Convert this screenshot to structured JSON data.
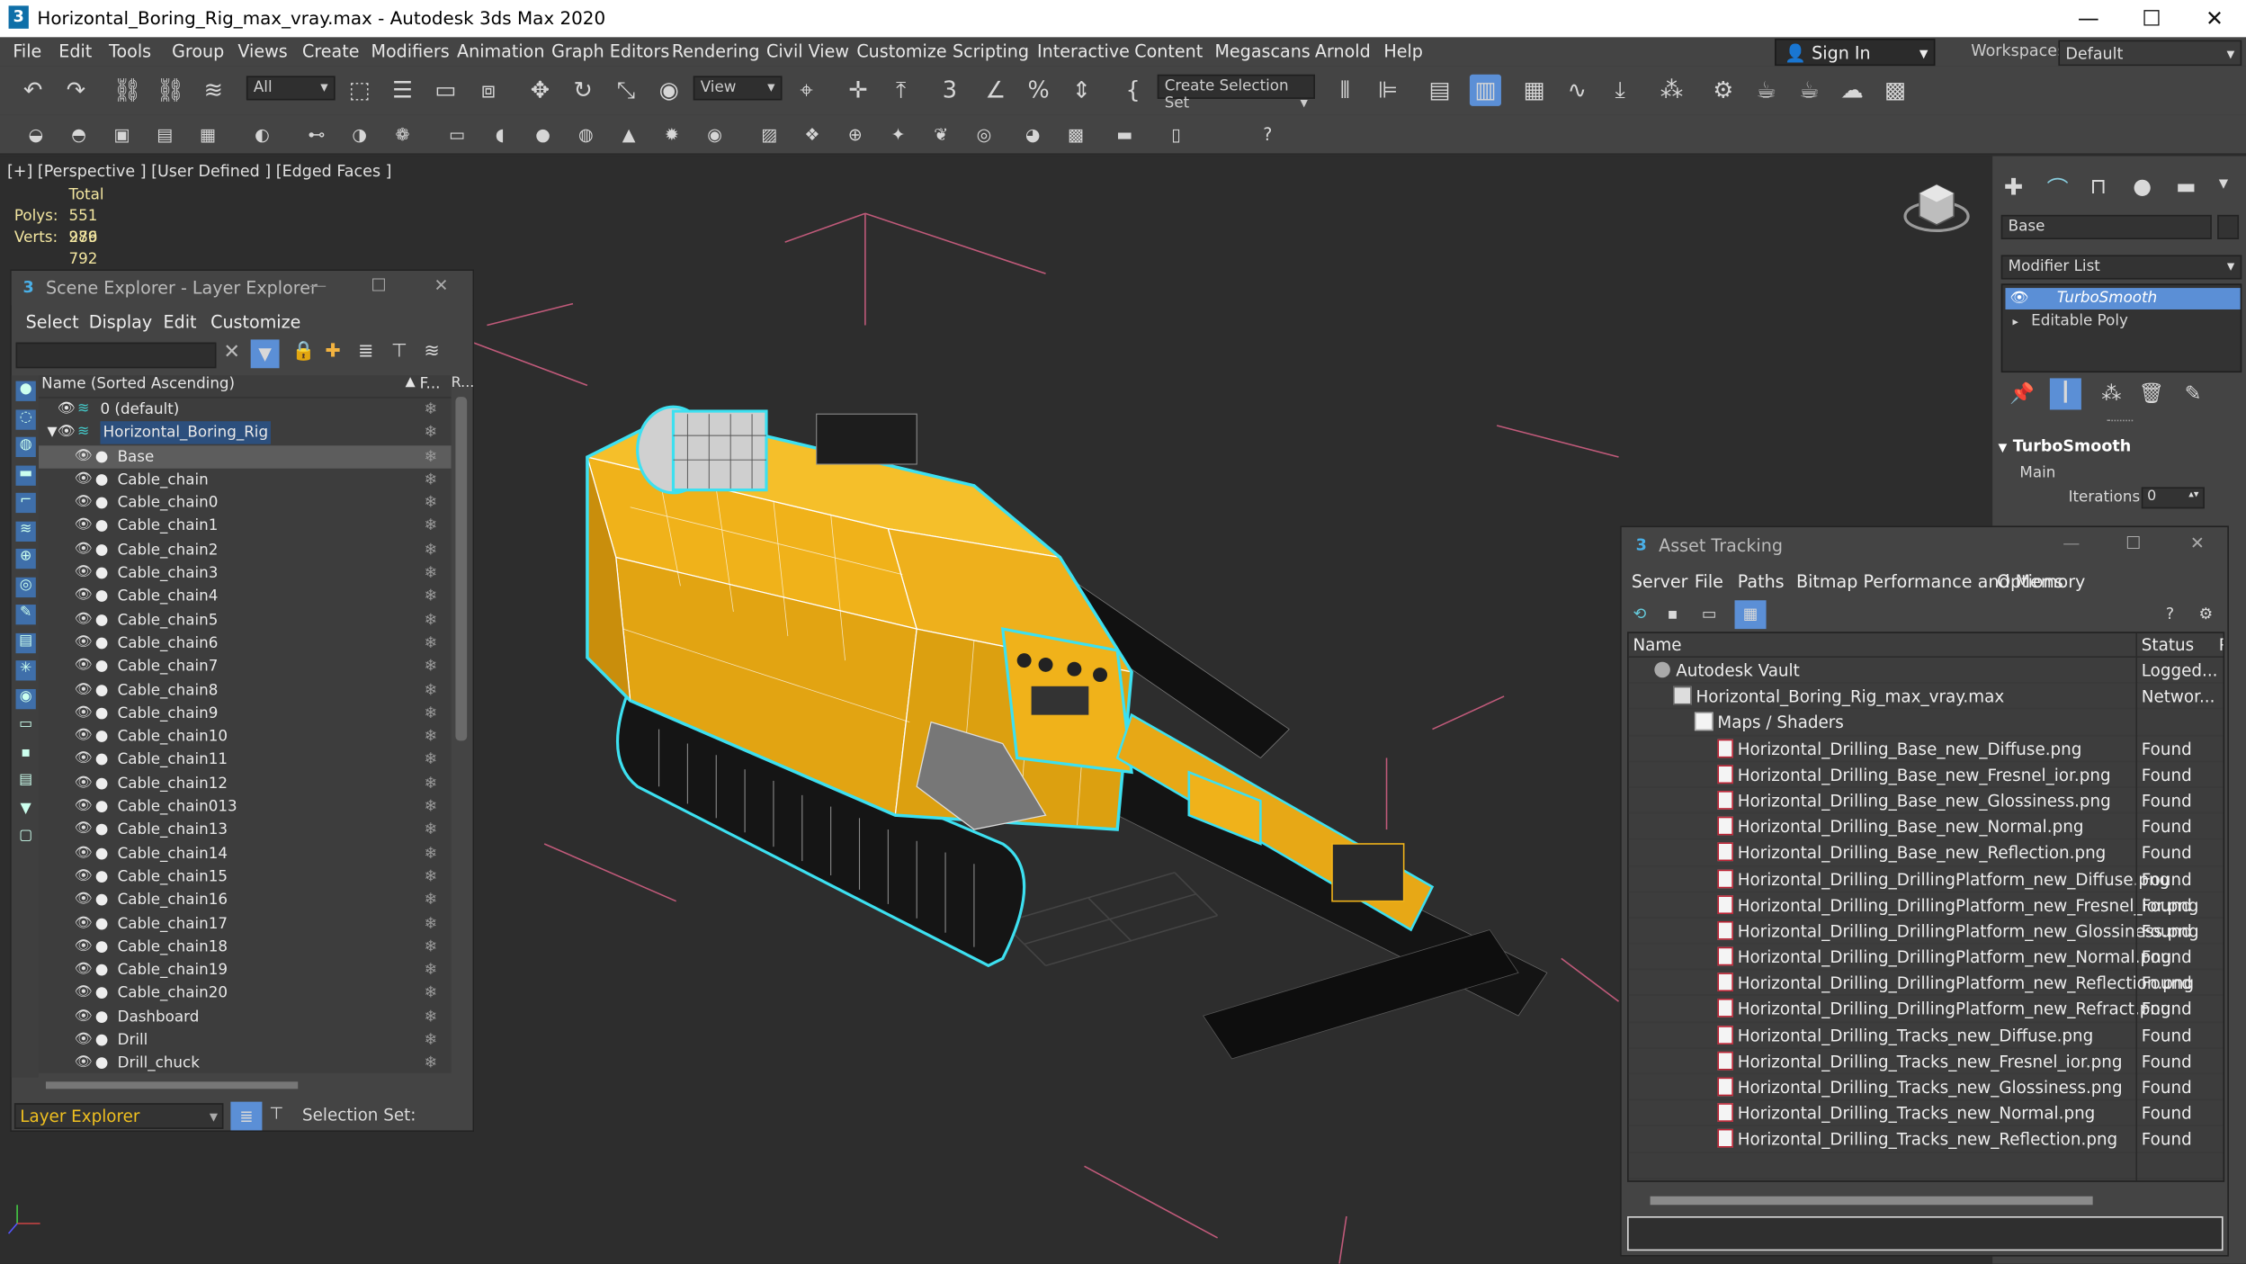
{
  "window": {
    "title": "Horizontal_Boring_Rig_max_vray.max - Autodesk 3ds Max 2020",
    "min": "—",
    "max": "☐",
    "close": "✕"
  },
  "menu": [
    "File",
    "Edit",
    "Tools",
    "Group",
    "Views",
    "Create",
    "Modifiers",
    "Animation",
    "Graph Editors",
    "Rendering",
    "Civil View",
    "Customize",
    "Scripting",
    "Interactive",
    "Content",
    "Megascans",
    "Arnold",
    "Help"
  ],
  "account": {
    "sign_in": "Sign In",
    "workspaces_label": "Workspaces:",
    "workspace": "Default"
  },
  "toolbar": {
    "filter": "All",
    "ref_coord": "View",
    "selection_set": "Create Selection Set"
  },
  "viewport": {
    "label": "[+] [Perspective ] [User Defined ] [Edged Faces ]",
    "stats_total": "Total",
    "polys_label": "Polys:",
    "polys": "551 989",
    "verts_label": "Verts:",
    "verts": "276 792"
  },
  "scene_explorer": {
    "title": "Scene Explorer - Layer Explorer",
    "menu": [
      "Select",
      "Display",
      "Edit",
      "Customize"
    ],
    "column_name": "Name (Sorted Ascending)",
    "column_f": "F...",
    "column_r": "R...",
    "rows": [
      {
        "name": "0 (default)",
        "level": 0
      },
      {
        "name": "Horizontal_Boring_Rig",
        "level": 0
      },
      {
        "name": "Base",
        "level": 1
      },
      {
        "name": "Cable_chain",
        "level": 1
      },
      {
        "name": "Cable_chain0",
        "level": 1
      },
      {
        "name": "Cable_chain1",
        "level": 1
      },
      {
        "name": "Cable_chain2",
        "level": 1
      },
      {
        "name": "Cable_chain3",
        "level": 1
      },
      {
        "name": "Cable_chain4",
        "level": 1
      },
      {
        "name": "Cable_chain5",
        "level": 1
      },
      {
        "name": "Cable_chain6",
        "level": 1
      },
      {
        "name": "Cable_chain7",
        "level": 1
      },
      {
        "name": "Cable_chain8",
        "level": 1
      },
      {
        "name": "Cable_chain9",
        "level": 1
      },
      {
        "name": "Cable_chain10",
        "level": 1
      },
      {
        "name": "Cable_chain11",
        "level": 1
      },
      {
        "name": "Cable_chain12",
        "level": 1
      },
      {
        "name": "Cable_chain013",
        "level": 1
      },
      {
        "name": "Cable_chain13",
        "level": 1
      },
      {
        "name": "Cable_chain14",
        "level": 1
      },
      {
        "name": "Cable_chain15",
        "level": 1
      },
      {
        "name": "Cable_chain16",
        "level": 1
      },
      {
        "name": "Cable_chain17",
        "level": 1
      },
      {
        "name": "Cable_chain18",
        "level": 1
      },
      {
        "name": "Cable_chain19",
        "level": 1
      },
      {
        "name": "Cable_chain20",
        "level": 1
      },
      {
        "name": "Dashboard",
        "level": 1
      },
      {
        "name": "Drill",
        "level": 1
      },
      {
        "name": "Drill_chuck",
        "level": 1
      }
    ],
    "footer_mode": "Layer Explorer",
    "selection_set_label": "Selection Set:"
  },
  "command_panel": {
    "object_name": "Base",
    "modifier_list": "Modifier List",
    "stack": [
      "TurboSmooth",
      "Editable Poly"
    ],
    "rollout_title": "TurboSmooth",
    "rollout_group": "Main",
    "iterations_label": "Iterations:",
    "iterations_value": "0"
  },
  "asset_tracking": {
    "title": "Asset Tracking",
    "menu": [
      "Server",
      "File",
      "Paths",
      "Bitmap Performance and Memory",
      "Options"
    ],
    "col_name": "Name",
    "col_status": "Status",
    "col_extra": "P",
    "rows": [
      {
        "name": "Autodesk Vault",
        "status": "Logged...",
        "indent": 0,
        "kind": "vault"
      },
      {
        "name": "Horizontal_Boring_Rig_max_vray.max",
        "status": "Networ...",
        "indent": 1,
        "kind": "max"
      },
      {
        "name": "Maps / Shaders",
        "status": "",
        "indent": 2,
        "kind": "folder"
      },
      {
        "name": "Horizontal_Drilling_Base_new_Diffuse.png",
        "status": "Found",
        "indent": 3,
        "kind": "file"
      },
      {
        "name": "Horizontal_Drilling_Base_new_Fresnel_ior.png",
        "status": "Found",
        "indent": 3,
        "kind": "file"
      },
      {
        "name": "Horizontal_Drilling_Base_new_Glossiness.png",
        "status": "Found",
        "indent": 3,
        "kind": "file"
      },
      {
        "name": "Horizontal_Drilling_Base_new_Normal.png",
        "status": "Found",
        "indent": 3,
        "kind": "file"
      },
      {
        "name": "Horizontal_Drilling_Base_new_Reflection.png",
        "status": "Found",
        "indent": 3,
        "kind": "file"
      },
      {
        "name": "Horizontal_Drilling_DrillingPlatform_new_Diffuse.png",
        "status": "Found",
        "indent": 3,
        "kind": "file"
      },
      {
        "name": "Horizontal_Drilling_DrillingPlatform_new_Fresnel_ior.png",
        "status": "Found",
        "indent": 3,
        "kind": "file"
      },
      {
        "name": "Horizontal_Drilling_DrillingPlatform_new_Glossiness.png",
        "status": "Found",
        "indent": 3,
        "kind": "file"
      },
      {
        "name": "Horizontal_Drilling_DrillingPlatform_new_Normal.png",
        "status": "Found",
        "indent": 3,
        "kind": "file"
      },
      {
        "name": "Horizontal_Drilling_DrillingPlatform_new_Reflection.png",
        "status": "Found",
        "indent": 3,
        "kind": "file"
      },
      {
        "name": "Horizontal_Drilling_DrillingPlatform_new_Refract.png",
        "status": "Found",
        "indent": 3,
        "kind": "file"
      },
      {
        "name": "Horizontal_Drilling_Tracks_new_Diffuse.png",
        "status": "Found",
        "indent": 3,
        "kind": "file"
      },
      {
        "name": "Horizontal_Drilling_Tracks_new_Fresnel_ior.png",
        "status": "Found",
        "indent": 3,
        "kind": "file"
      },
      {
        "name": "Horizontal_Drilling_Tracks_new_Glossiness.png",
        "status": "Found",
        "indent": 3,
        "kind": "file"
      },
      {
        "name": "Horizontal_Drilling_Tracks_new_Normal.png",
        "status": "Found",
        "indent": 3,
        "kind": "file"
      },
      {
        "name": "Horizontal_Drilling_Tracks_new_Reflection.png",
        "status": "Found",
        "indent": 3,
        "kind": "file"
      }
    ]
  },
  "colors": {
    "model_yellow": "#f2b41a",
    "selection_cyan": "#3de0f0",
    "grid_pink": "#c05a7a",
    "stats_yellow": "#f3e6a0",
    "accent_blue": "#5b8fd6"
  }
}
